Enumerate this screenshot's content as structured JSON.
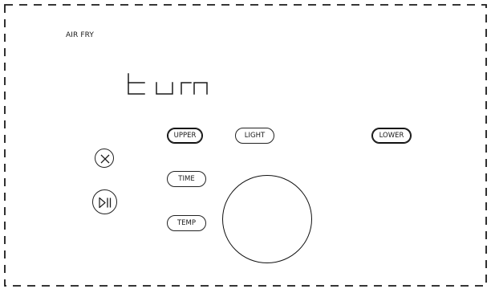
{
  "panel": {
    "mode_label": "AIR FRY",
    "display_text": "turn"
  },
  "buttons": {
    "upper": {
      "label": "UPPER",
      "active": true
    },
    "light": {
      "label": "LIGHT",
      "active": false
    },
    "lower": {
      "label": "LOWER",
      "active": true
    },
    "time": {
      "label": "TIME",
      "active": false
    },
    "temp": {
      "label": "TEMP",
      "active": false
    }
  },
  "icons": {
    "cancel": "close-circle-icon",
    "start_pause": "play-pause-icon",
    "dial": "control-dial"
  },
  "colors": {
    "ink": "#1a1a1a",
    "background": "#ffffff"
  }
}
